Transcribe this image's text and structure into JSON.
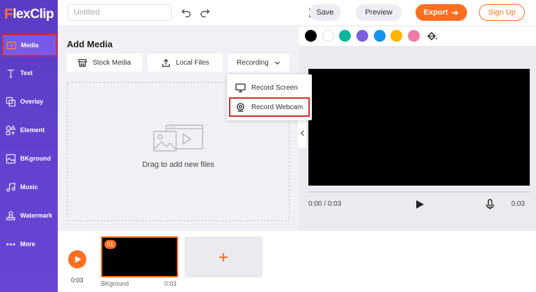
{
  "app": {
    "logo_mark": "F",
    "logo_text": "lexClip"
  },
  "topbar": {
    "title_placeholder": "Untitled",
    "save_label": "Save",
    "preview_label": "Preview",
    "export_label": "Export",
    "signup_label": "Sign Up"
  },
  "sidebar": {
    "items": [
      {
        "label": "Media",
        "icon": "media-icon",
        "active": true
      },
      {
        "label": "Text",
        "icon": "text-icon",
        "active": false
      },
      {
        "label": "Overlay",
        "icon": "overlay-icon",
        "active": false
      },
      {
        "label": "Element",
        "icon": "element-icon",
        "active": false
      },
      {
        "label": "BKground",
        "icon": "background-icon",
        "active": false
      },
      {
        "label": "Music",
        "icon": "music-icon",
        "active": false
      },
      {
        "label": "Watermark",
        "icon": "watermark-icon",
        "active": false
      },
      {
        "label": "More",
        "icon": "more-icon",
        "active": false
      }
    ]
  },
  "panel": {
    "title": "Add Media",
    "stock_media_label": "Stock Media",
    "local_files_label": "Local Files",
    "recording_label": "Recording",
    "drop_text": "Drag to add new files"
  },
  "recording_menu": {
    "items": [
      {
        "label": "Record Screen",
        "icon": "monitor-icon"
      },
      {
        "label": "Record Webcam",
        "icon": "webcam-icon",
        "highlighted": true
      }
    ]
  },
  "colors": {
    "swatches": [
      "#000000",
      "#ffffff",
      "#10b3a0",
      "#7d5fe0",
      "#1595ef",
      "#ffb400",
      "#f37aa4"
    ],
    "accent": "#ff6d1f",
    "sidebar": "#5b3cc4"
  },
  "player": {
    "current_time": "0:00 / 0:03",
    "duration": "0:03"
  },
  "timeline": {
    "total_time": "0:03",
    "clips": [
      {
        "number": "01",
        "label": "BKground",
        "duration": "0:03"
      }
    ]
  }
}
